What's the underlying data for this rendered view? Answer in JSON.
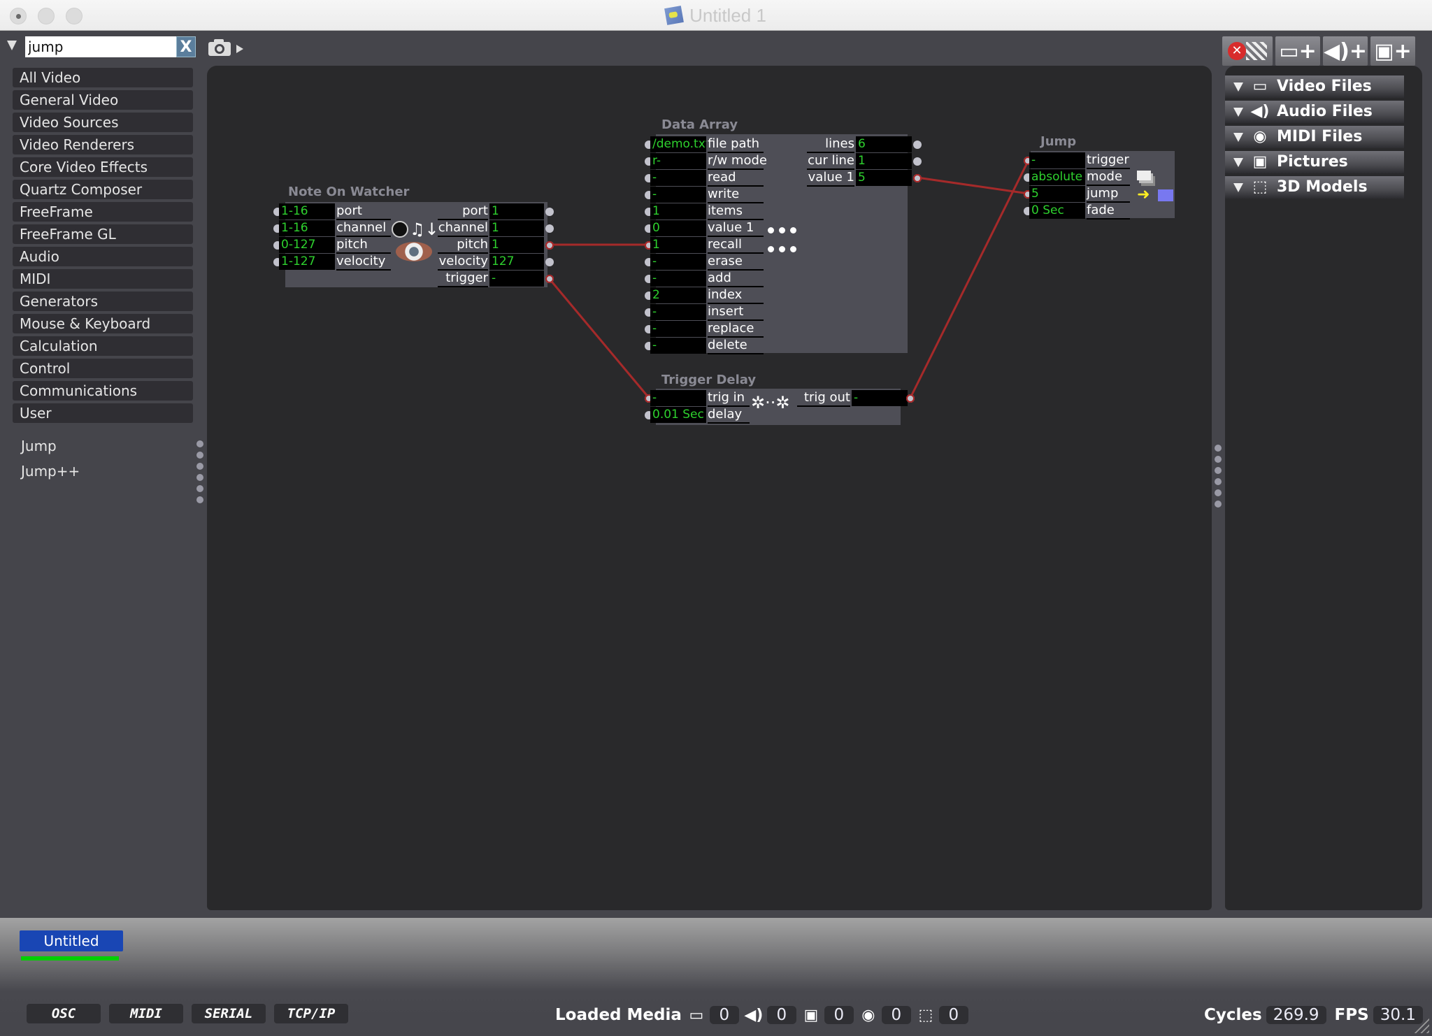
{
  "window": {
    "title": "Untitled 1"
  },
  "search": {
    "value": "jump",
    "clear_label": "X"
  },
  "sidebar": {
    "categories": [
      "All Video",
      "General Video",
      "Video Sources",
      "Video Renderers",
      "Core Video Effects",
      "Quartz Composer",
      "FreeFrame",
      "FreeFrame GL",
      "Audio",
      "MIDI",
      "Generators",
      "Mouse & Keyboard",
      "Calculation",
      "Control",
      "Communications",
      "User"
    ],
    "results": [
      "Jump",
      "Jump++"
    ]
  },
  "modules": {
    "note_on_watcher": {
      "title": "Note On Watcher",
      "inputs": [
        {
          "value": "1-16",
          "label": "port"
        },
        {
          "value": "1-16",
          "label": "channel"
        },
        {
          "value": "0-127",
          "label": "pitch"
        },
        {
          "value": "1-127",
          "label": "velocity"
        }
      ],
      "outputs": [
        {
          "label": "port",
          "value": "1"
        },
        {
          "label": "channel",
          "value": "1"
        },
        {
          "label": "pitch",
          "value": "1"
        },
        {
          "label": "velocity",
          "value": "127"
        },
        {
          "label": "trigger",
          "value": "-"
        }
      ]
    },
    "data_array": {
      "title": "Data Array",
      "inputs": [
        {
          "value": "/demo.txt",
          "label": "file path"
        },
        {
          "value": "r-",
          "label": "r/w mode"
        },
        {
          "value": "-",
          "label": "read"
        },
        {
          "value": "-",
          "label": "write"
        },
        {
          "value": "1",
          "label": "items"
        },
        {
          "value": "0",
          "label": "value 1"
        },
        {
          "value": "1",
          "label": "recall"
        },
        {
          "value": "-",
          "label": "erase"
        },
        {
          "value": "-",
          "label": "add"
        },
        {
          "value": "2",
          "label": "index"
        },
        {
          "value": "-",
          "label": "insert"
        },
        {
          "value": "-",
          "label": "replace"
        },
        {
          "value": "-",
          "label": "delete"
        }
      ],
      "outputs": [
        {
          "label": "lines",
          "value": "6"
        },
        {
          "label": "cur line",
          "value": "1"
        },
        {
          "label": "value 1",
          "value": "5"
        }
      ]
    },
    "trigger_delay": {
      "title": "Trigger Delay",
      "inputs": [
        {
          "value": "-",
          "label": "trig in"
        },
        {
          "value": "0.01 Sec",
          "label": "delay"
        }
      ],
      "outputs": [
        {
          "label": "trig out",
          "value": "-"
        }
      ]
    },
    "jump": {
      "title": "Jump",
      "inputs": [
        {
          "value": "-",
          "label": "trigger"
        },
        {
          "value": "absolute",
          "label": "mode"
        },
        {
          "value": "5",
          "label": "jump"
        },
        {
          "value": "0 Sec",
          "label": "fade"
        }
      ]
    }
  },
  "media_panel": {
    "toolbar": [
      "stop-all",
      "add-video",
      "add-audio",
      "add-picture"
    ],
    "sections": [
      {
        "label": "Video Files",
        "icon": "film-icon"
      },
      {
        "label": "Audio Files",
        "icon": "speaker-icon"
      },
      {
        "label": "MIDI Files",
        "icon": "midi-icon"
      },
      {
        "label": "Pictures",
        "icon": "picture-icon"
      },
      {
        "label": "3D Models",
        "icon": "cube-icon"
      }
    ]
  },
  "bottom": {
    "project_tab": "Untitled",
    "project_progress": 1.0,
    "protocols": [
      "OSC",
      "MIDI",
      "SERIAL",
      "TCP/IP"
    ],
    "loaded_media_label": "Loaded Media",
    "loaded_media": {
      "video": "0",
      "audio": "0",
      "pictures": "0",
      "midi": "0",
      "models": "0"
    },
    "cycles_label": "Cycles",
    "cycles": "269.9",
    "fps_label": "FPS",
    "fps": "30.1"
  },
  "colors": {
    "wire": "#a52a2a",
    "value_text": "#2ed12e",
    "project_tab": "#1946b4",
    "progress": "#00d000"
  }
}
